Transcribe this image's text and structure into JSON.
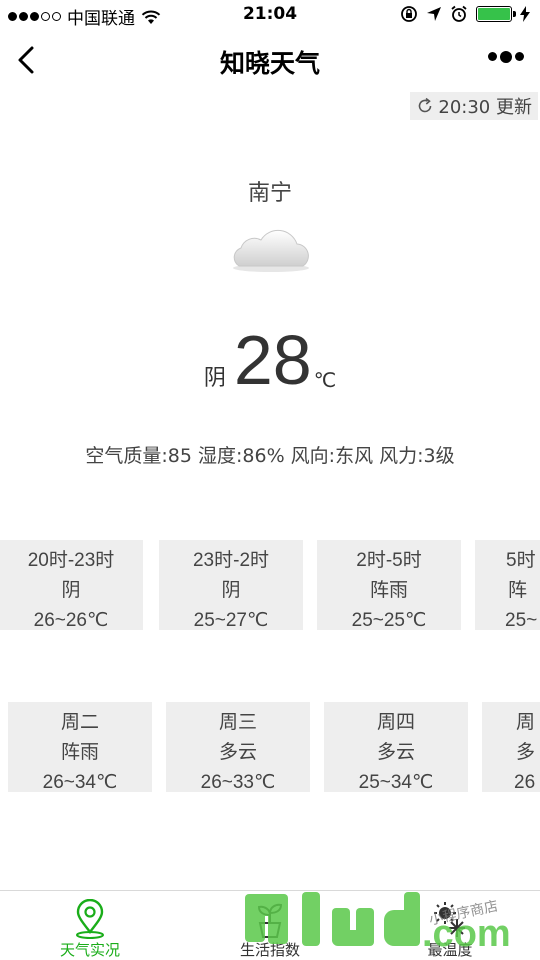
{
  "status_bar": {
    "carrier": "中国联通",
    "time": "21:04",
    "battery_color": "#36c24a"
  },
  "nav": {
    "title": "知晓天气"
  },
  "refresh": {
    "label": "20:30 更新"
  },
  "current": {
    "city": "南宁",
    "icon": "cloud-icon",
    "condition": "阴",
    "temperature": "28",
    "unit": "℃",
    "details": "空气质量:85 湿度:86% 风向:东风 风力:3级"
  },
  "hourly": [
    {
      "time": "20时-23时",
      "condition": "阴",
      "range": "26~26℃"
    },
    {
      "time": "23时-2时",
      "condition": "阴",
      "range": "25~27℃"
    },
    {
      "time": "2时-5时",
      "condition": "阵雨",
      "range": "25~25℃"
    },
    {
      "time": "5时",
      "condition": "阵",
      "range": "25~"
    }
  ],
  "daily": [
    {
      "day": "周二",
      "condition": "阵雨",
      "range": "26~34℃"
    },
    {
      "day": "周三",
      "condition": "多云",
      "range": "26~33℃"
    },
    {
      "day": "周四",
      "condition": "多云",
      "range": "25~34℃"
    },
    {
      "day": "周",
      "condition": "多",
      "range": "26"
    }
  ],
  "tabs": [
    {
      "label": "天气实况",
      "icon": "location-pin-icon",
      "active": true
    },
    {
      "label": "生活指数",
      "icon": "plant-pot-icon",
      "active": false
    },
    {
      "label": "最温度",
      "icon": "sun-snow-icon",
      "active": false
    }
  ],
  "watermark": {
    "text": "91ud.com",
    "subtext": "小程序商店"
  },
  "colors": {
    "accent": "#1aad19",
    "card_bg": "#eeeeee"
  }
}
